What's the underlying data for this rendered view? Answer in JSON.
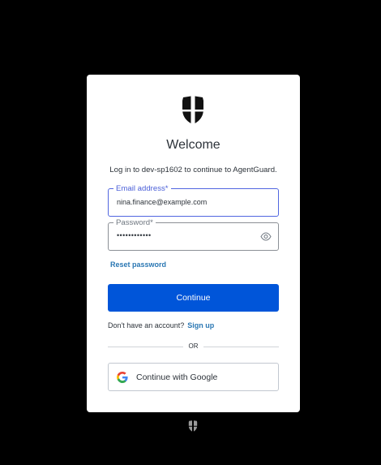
{
  "app": {
    "name": "AgentGuard",
    "tenant": "dev-sp1602"
  },
  "login": {
    "title": "Welcome",
    "subtitle": "Log in to dev-sp1602 to continue to AgentGuard.",
    "email": {
      "label": "Email address*",
      "value": "nina.finance@example.com"
    },
    "password": {
      "label": "Password*",
      "value": "••••••••••••"
    },
    "reset_label": "Reset password",
    "continue_label": "Continue",
    "signup_prompt": "Don't have an account?",
    "signup_label": "Sign up",
    "divider_label": "OR",
    "google_label": "Continue with Google"
  },
  "icons": {
    "logo": "shield-logo-icon",
    "password_toggle": "eye-icon",
    "google": "google-icon",
    "footer": "shield-logo-icon"
  },
  "colors": {
    "background": "#000000",
    "card": "#ffffff",
    "primary": "#0055d9",
    "focus": "#5166e0",
    "link": "#2a77b3",
    "text": "#2d333a"
  }
}
